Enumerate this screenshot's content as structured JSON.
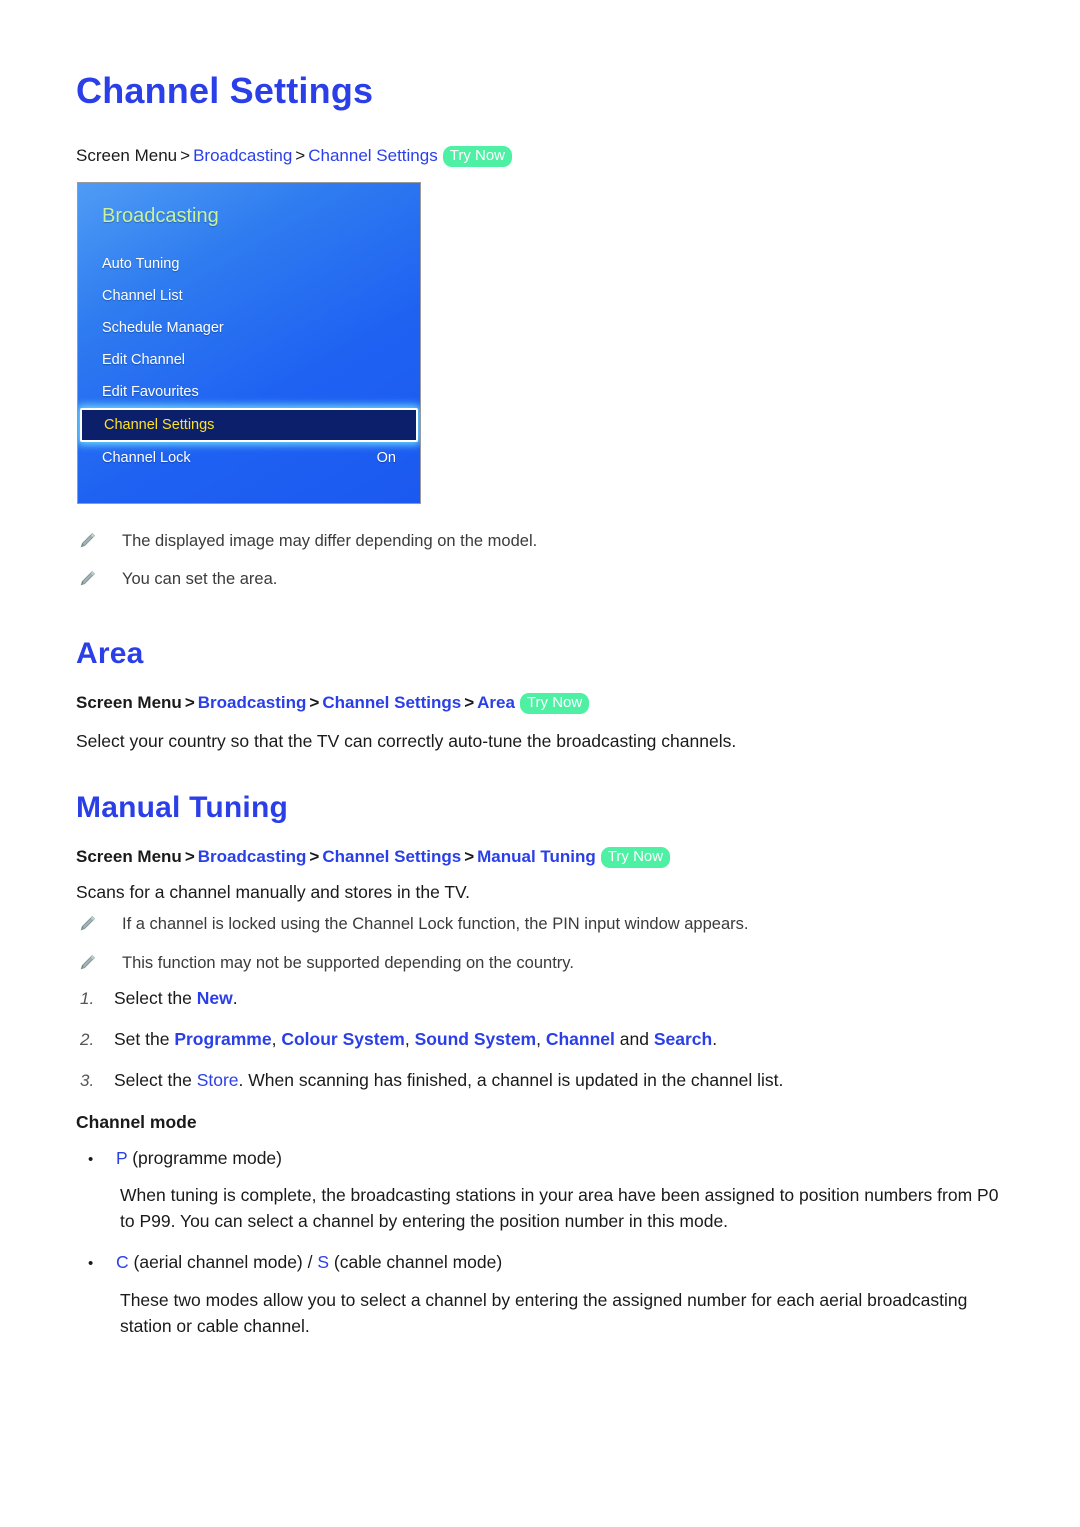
{
  "document": {
    "title": "Channel Settings"
  },
  "breadcrumbs": {
    "channel_settings": {
      "root": "Screen Menu",
      "sep": ">",
      "item1": "Broadcasting",
      "item2": "Channel Settings",
      "try_now": "Try Now"
    },
    "area": {
      "root": "Screen Menu",
      "sep": ">",
      "item1": "Broadcasting",
      "item2": "Channel Settings",
      "item3": "Area",
      "try_now": "Try Now"
    },
    "manual_tuning": {
      "root": "Screen Menu",
      "sep": ">",
      "item1": "Broadcasting",
      "item2": "Channel Settings",
      "item3": "Manual Tuning",
      "try_now": "Try Now"
    }
  },
  "tv_menu": {
    "header": "Broadcasting",
    "items": [
      {
        "label": "Auto Tuning",
        "value": ""
      },
      {
        "label": "Channel List",
        "value": ""
      },
      {
        "label": "Schedule Manager",
        "value": ""
      },
      {
        "label": "Edit Channel",
        "value": ""
      },
      {
        "label": "Edit Favourites",
        "value": ""
      },
      {
        "label": "Channel Settings",
        "value": "",
        "selected": true
      },
      {
        "label": "Channel Lock",
        "value": "On"
      }
    ],
    "colors": {
      "background_top": "#4f9cf5",
      "background_bottom": "#1b59f0",
      "header_text": "#c9f39b",
      "item_text": "#ffffff",
      "selected_background": "#0b1f6b",
      "selected_text": "#ffe21f",
      "selected_glow": "#78e6ff"
    }
  },
  "notes": {
    "note1": "The displayed image may differ depending on the model.",
    "note2": "You can set the area.",
    "note3": "If a channel is locked using the Channel Lock function, the PIN input window appears.",
    "note4": "This function may not be supported depending on the country."
  },
  "sections": {
    "area": {
      "title": "Area",
      "body": "Select your country so that the TV can correctly auto-tune the broadcasting channels."
    },
    "manual_tuning": {
      "title": "Manual Tuning",
      "body": "Scans for a channel manually and stores in the TV."
    }
  },
  "steps": [
    {
      "number": "1.",
      "pre": "Select the ",
      "link": "New",
      "post": "."
    },
    {
      "number": "2.",
      "pre": "Set the ",
      "terms": [
        "Programme",
        "Colour System",
        "Sound System",
        "Channel"
      ],
      "conj": " and ",
      "last_term": "Search",
      "post": "."
    },
    {
      "number": "3.",
      "pre": "Select the ",
      "link": "Store",
      "post": ". When scanning has finished, a channel is updated in the channel list."
    }
  ],
  "channel_mode": {
    "heading": "Channel mode",
    "bullet_glyph": "•",
    "p_mode": {
      "key": "P",
      "label": " (programme mode)",
      "description": "When tuning is complete, the broadcasting stations in your area have been assigned to position numbers from P0 to P99. You can select a channel by entering the position number in this mode."
    },
    "cs_mode": {
      "key_c": "C",
      "label_c": " (aerial channel mode) / ",
      "key_s": "S",
      "label_s": " (cable channel mode)",
      "description": "These two modes allow you to select a channel by entering the assigned number for each aerial broadcasting station or cable channel."
    }
  },
  "theme": {
    "link_blue": "#2a3fe8",
    "try_now_green": "#4ef0a3",
    "body_text": "#1a1a1a",
    "note_text": "#3b3b3b",
    "pencil_icon": "#8fa3a5"
  }
}
